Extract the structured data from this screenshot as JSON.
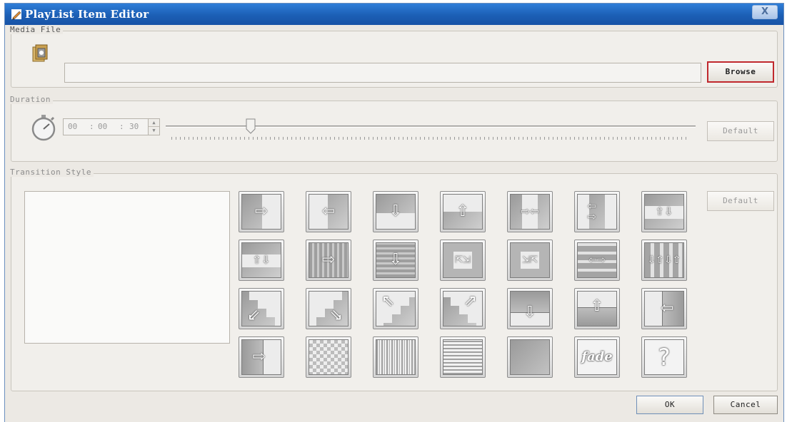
{
  "window": {
    "title": "PlayList Item Editor",
    "close_label": "X"
  },
  "media_file": {
    "legend": "Media File",
    "path_value": "",
    "browse_label": "Browse"
  },
  "duration": {
    "legend": "Duration",
    "hh": "00",
    "mm": "00",
    "ss": "30",
    "sep": ":",
    "slider_position": 0.16,
    "default_label": "Default"
  },
  "transition": {
    "legend": "Transition Style",
    "default_label": "Default",
    "fade_label": "fade",
    "unknown_label": "?"
  },
  "footer": {
    "ok_label": "OK",
    "cancel_label": "Cancel"
  },
  "colors": {
    "title_bar": "#1c5fb5",
    "browse_highlight": "#c0282d",
    "tile_gray": "#a8a8a8"
  },
  "icons": [
    "app-pencil-icon",
    "media-file-icon",
    "stopwatch-icon",
    "spinner-icon",
    "transition-tiles"
  ]
}
